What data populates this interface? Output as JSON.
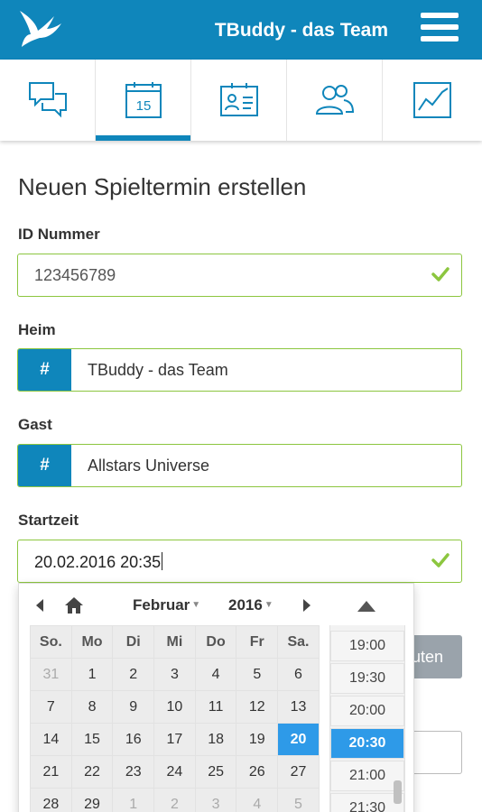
{
  "header": {
    "title": "TBuddy - das Team",
    "logo_icon": "bird-logo-icon",
    "menu_icon": "hamburger-menu-icon"
  },
  "tabs": [
    {
      "icon": "chat-bubbles-icon",
      "active": false
    },
    {
      "icon": "calendar-icon",
      "label": "15",
      "active": true
    },
    {
      "icon": "contact-card-icon",
      "active": false
    },
    {
      "icon": "people-icon",
      "active": false
    },
    {
      "icon": "line-chart-icon",
      "active": false
    }
  ],
  "form": {
    "title": "Neuen Spieltermin erstellen",
    "id_label": "ID Nummer",
    "id_value": "123456789",
    "home_label": "Heim",
    "home_addon": "#",
    "home_value": "TBuddy - das Team",
    "guest_label": "Gast",
    "guest_addon": "#",
    "guest_value": "Allstars Universe",
    "start_label": "Startzeit",
    "start_value": "20.02.2016 20:35",
    "hidden_button_label": "uten"
  },
  "datepicker": {
    "month": "Februar",
    "year": "2016",
    "weekdays": [
      "So.",
      "Mo",
      "Di",
      "Mi",
      "Do",
      "Fr",
      "Sa."
    ],
    "weeks": [
      [
        "31",
        "1",
        "2",
        "3",
        "4",
        "5",
        "6"
      ],
      [
        "7",
        "8",
        "9",
        "10",
        "11",
        "12",
        "13"
      ],
      [
        "14",
        "15",
        "16",
        "17",
        "18",
        "19",
        "20"
      ],
      [
        "21",
        "22",
        "23",
        "24",
        "25",
        "26",
        "27"
      ],
      [
        "28",
        "29",
        "1",
        "2",
        "3",
        "4",
        "5"
      ]
    ],
    "selected_day": "20",
    "times": [
      "19:00",
      "19:30",
      "20:00",
      "20:30",
      "21:00",
      "21:30"
    ],
    "selected_time": "20:30",
    "colors": {
      "brand": "#0f86bb",
      "selected": "#2e9ae8",
      "valid": "#8cc63f"
    }
  }
}
